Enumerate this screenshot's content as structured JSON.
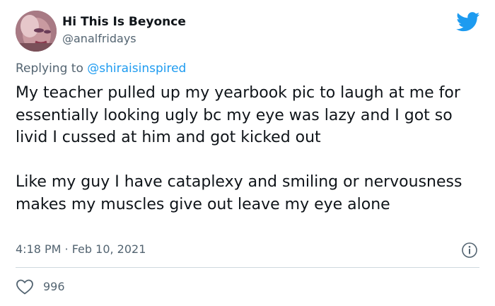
{
  "author": {
    "display_name": "Hi This Is Beyonce",
    "handle": "@analfridays"
  },
  "reply": {
    "prefix": "Replying to ",
    "mention": "@shiraisinspired"
  },
  "tweet": {
    "text": "My teacher pulled up my yearbook pic to laugh at me for essentially looking ugly bc my eye was lazy and I got so livid I cussed at him and got kicked out\n\nLike my guy I have cataplexy and smiling or nervousness makes my muscles give out leave my eye alone",
    "timestamp": "4:18 PM · Feb 10, 2021",
    "likes": "996"
  },
  "icons": {
    "brand": "twitter-bird-icon",
    "info": "info-icon",
    "like": "heart-icon"
  },
  "colors": {
    "accent": "#1d9bf0",
    "secondary_text": "#536471",
    "primary_text": "#0f1419",
    "divider": "#cfd9de"
  }
}
